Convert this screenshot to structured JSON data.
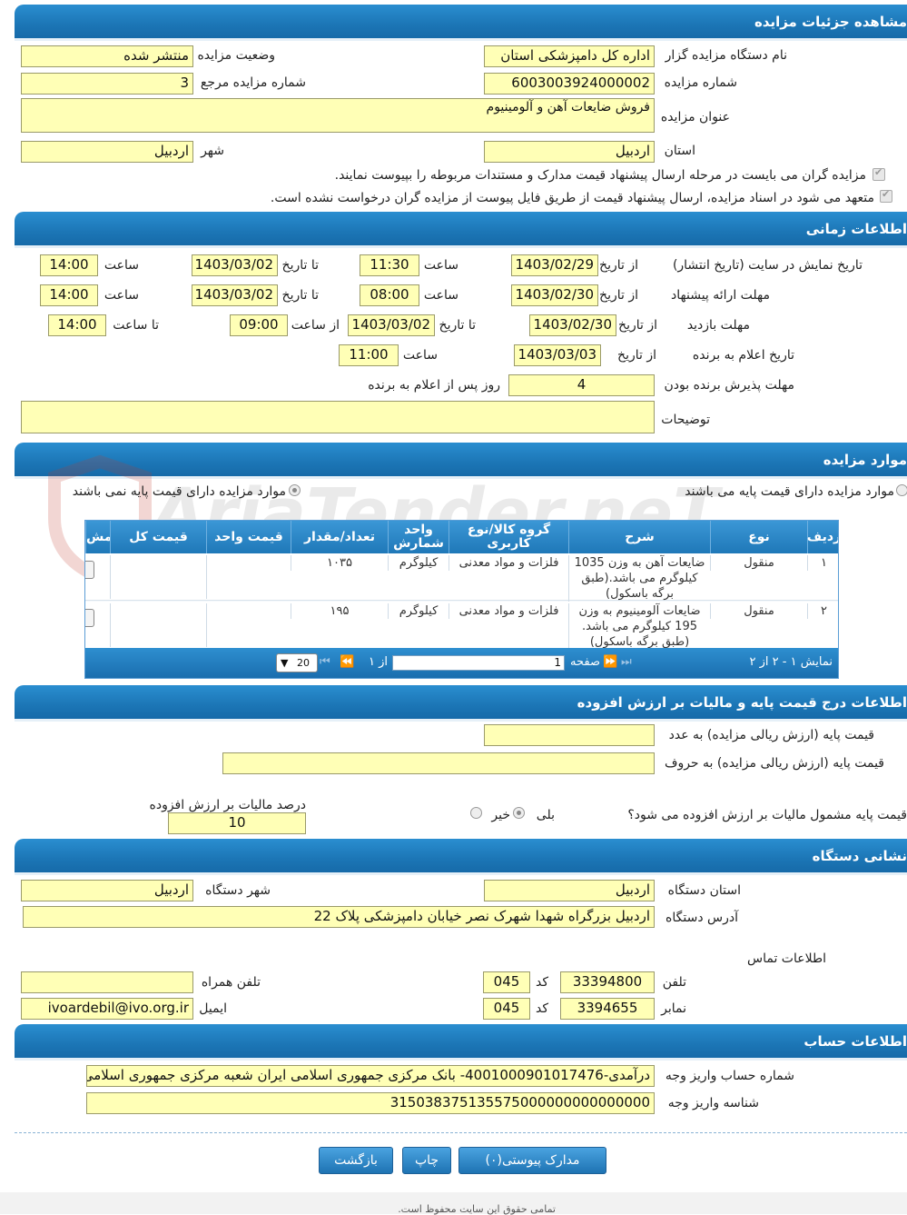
{
  "sections": {
    "details": "مشاهده جزئیات مزایده",
    "time": "اطلاعات زمانی",
    "items": "موارد مزایده",
    "price": "اطلاعات درج قیمت پایه و مالیات بر ارزش افزوده",
    "address": "نشانی دستگاه",
    "account": "اطلاعات حساب"
  },
  "details": {
    "org_label": "نام دستگاه مزایده گزار",
    "org_value": "اداره کل دامپزشکی استان",
    "status_label": "وضعیت مزایده",
    "status_value": "منتشر شده",
    "number_label": "شماره مزایده",
    "number_value": "6003003924000002",
    "ref_label": "شماره مزایده مرجع",
    "ref_value": "3",
    "title_label": "عنوان مزایده",
    "title_value": "فروش ضایعات آهن و آلومینیوم",
    "province_label": "استان",
    "province_value": "اردبیل",
    "city_label": "شهر",
    "city_value": "اردبیل",
    "check1": "مزایده گران می بایست در مرحله ارسال پیشنهاد قیمت مدارک و مستندات مربوطه را بپیوست نمایند.",
    "check2": "متعهد می شود در اسناد مزایده، ارسال پیشنهاد قیمت از طریق فایل پیوست از مزایده گران درخواست نشده است."
  },
  "time": {
    "display_label": "تاریخ نمایش در سایت (تاریخ انتشار)",
    "offer_label": "مهلت ارائه پیشنهاد",
    "visit_label": "مهلت بازدید",
    "winner_label": "تاریخ اعلام به برنده",
    "accept_label": "مهلت پذیرش برنده بودن",
    "desc_label": "توضیحات",
    "from_date": "از تاریخ",
    "to_date": "تا تاریخ",
    "hour": "ساعت",
    "from_hour": "از ساعت",
    "to_hour": "تا ساعت",
    "display_from": "1403/02/29",
    "display_from_time": "11:30",
    "display_to": "1403/03/02",
    "display_to_time": "14:00",
    "offer_from": "1403/02/30",
    "offer_from_time": "08:00",
    "offer_to": "1403/03/02",
    "offer_to_time": "14:00",
    "visit_from": "1403/02/30",
    "visit_to": "1403/03/02",
    "visit_from_time": "09:00",
    "visit_to_time": "14:00",
    "winner_date": "1403/03/03",
    "winner_time": "11:00",
    "accept_days": "4",
    "accept_suffix": "روز پس از اعلام به برنده",
    "desc_value": ""
  },
  "items": {
    "opt_has_base": "موارد مزایده دارای قیمت پایه می باشند",
    "opt_no_base": "موارد مزایده دارای قیمت پایه نمی باشند",
    "headers": [
      "ردیف",
      "نوع",
      "شرح",
      "گروه کالا/نوع کاربری",
      "واحد شمارش",
      "تعداد/مقدار",
      "قیمت واحد",
      "قیمت کل",
      "مش"
    ],
    "rows": [
      {
        "idx": "۱",
        "type": "منقول",
        "desc": "ضایعات آهن به وزن 1035 کیلوگرم می باشد.(طبق برگه باسکول)",
        "group": "فلزات و مواد معدنی",
        "unit": "کیلوگرم",
        "qty": "۱۰۳۵",
        "unit_price": "",
        "total": ""
      },
      {
        "idx": "۲",
        "type": "منقول",
        "desc": "ضایعات آلومینیوم به وزن 195 کیلوگرم می باشد. (طبق برگه باسکول)",
        "group": "فلزات و مواد معدنی",
        "unit": "کیلوگرم",
        "qty": "۱۹۵",
        "unit_price": "",
        "total": ""
      }
    ],
    "pager_info": "نمایش ۱ - ۲ از ۲",
    "page_label": "صفحه",
    "page_value": "1",
    "of_label": "از ۱",
    "page_size": "20"
  },
  "price": {
    "base_num_label": "قیمت پایه (ارزش ریالی مزایده) به عدد",
    "base_text_label": "قیمت پایه (ارزش ریالی مزایده) به حروف",
    "vat_question": "قیمت پایه مشمول مالیات بر ارزش افزوده می شود؟",
    "yes": "بلی",
    "no": "خیر",
    "vat_percent_label": "درصد مالیات بر ارزش افزوده",
    "vat_percent": "10"
  },
  "address": {
    "province_label": "استان دستگاه",
    "province_value": "اردبیل",
    "city_label": "شهر دستگاه",
    "city_value": "اردبیل",
    "addr_label": "آدرس دستگاه",
    "addr_value": "اردبیل بزرگراه شهدا شهرک نصر خیابان دامپزشکی پلاک 22",
    "contact_label": "اطلاعات تماس",
    "phone_label": "تلفن",
    "phone_value": "33394800",
    "code_label": "کد",
    "phone_code": "045",
    "fax_label": "نمابر",
    "fax_value": "3394655",
    "fax_code": "045",
    "mobile_label": "تلفن همراه",
    "mobile_value": "",
    "email_label": "ایمیل",
    "email_value": "ivoardebil@ivo.org.ir"
  },
  "account": {
    "acc_label": "شماره حساب واریز وجه",
    "acc_value": "درآمدی-4001000901017476- بانک مرکزی جمهوری اسلامی ایران شعبه مرکزی جمهوری اسلامی ایران",
    "id_label": "شناسه واریز وجه",
    "id_value": "315038375135575000000000000000"
  },
  "buttons": {
    "docs": "مدارک پیوستی(۰)",
    "print": "چاپ",
    "back": "بازگشت"
  },
  "footer": "تمامی حقوق این سایت محفوظ است.",
  "watermark": "AriaTender.neT"
}
